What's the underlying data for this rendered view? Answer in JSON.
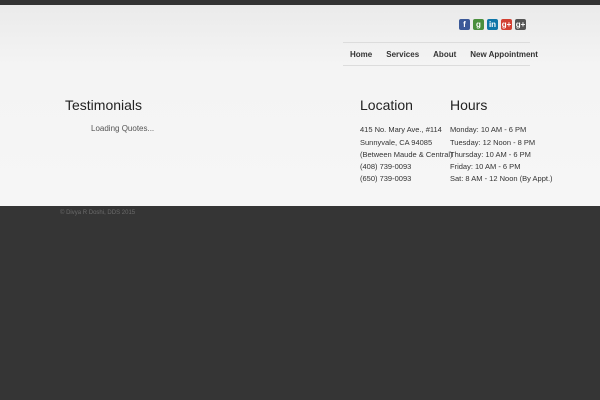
{
  "social": [
    {
      "name": "facebook",
      "glyph": "f",
      "color": "#3b5998"
    },
    {
      "name": "google-places",
      "glyph": "g",
      "color": "#4a8f3c"
    },
    {
      "name": "linkedin",
      "glyph": "in",
      "color": "#0e76a8"
    },
    {
      "name": "google-plus",
      "glyph": "g+",
      "color": "#d23f31"
    },
    {
      "name": "google-plus-dark",
      "glyph": "g+",
      "color": "#555555"
    }
  ],
  "nav": {
    "home": "Home",
    "services": "Services",
    "about": "About",
    "new_appointment": "New Appointment"
  },
  "testimonials": {
    "title": "Testimonials",
    "loading": "Loading Quotes..."
  },
  "location": {
    "title": "Location",
    "lines": [
      "415 No. Mary Ave., #114",
      "Sunnyvale, CA 94085",
      "(Between Maude & Central)",
      "(408) 739-0093",
      "(650) 739-0093"
    ]
  },
  "hours": {
    "title": "Hours",
    "lines": [
      "Monday: 10 AM - 6 PM",
      "Tuesday: 12 Noon - 8 PM",
      "Thursday: 10 AM - 6 PM",
      "Friday: 10 AM - 6 PM",
      "Sat: 8 AM - 12 Noon (By Appt.)"
    ]
  },
  "footer": {
    "copyright": "© Divya R Doshi, DDS 2015"
  }
}
